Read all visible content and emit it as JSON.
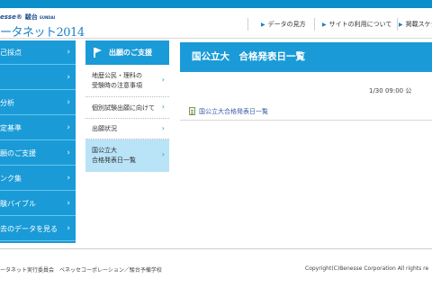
{
  "colors": {
    "accent": "#1a9bd7",
    "active_bg": "#b9e3f7",
    "link": "#3a5fa8"
  },
  "header": {
    "logo_brand": "esse®",
    "logo_sundai": "駿台",
    "logo_sundai_en": "SUNDAI",
    "logo_title": "ータネット2014",
    "links": [
      {
        "label": "データの見方",
        "icon": "arrow-right-icon"
      },
      {
        "label": "サイトの利用について",
        "icon": "arrow-right-icon"
      },
      {
        "label": "掲載スケジュー",
        "icon": "arrow-right-icon"
      }
    ]
  },
  "sidebar": {
    "items": [
      {
        "label": "己採点"
      },
      {
        "label": ""
      },
      {
        "label": "分析"
      },
      {
        "label": "定基準"
      },
      {
        "label": "願のご支援"
      },
      {
        "label": "ンク集"
      },
      {
        "label": "験バイブル"
      },
      {
        "label": "去のデータを見る"
      }
    ]
  },
  "submenu": {
    "title": "出願のご支援",
    "items": [
      {
        "line1": "地歴公民・理科の",
        "line2": "受験時の注意事項"
      },
      {
        "line1": "個別試験出願に向けて",
        "line2": ""
      },
      {
        "line1": "出願状況",
        "line2": ""
      },
      {
        "line1": "国公立大",
        "line2": "合格発表日一覧"
      }
    ]
  },
  "main": {
    "title": "国公立大　合格発表日一覧",
    "update": "1/30 09:00 公",
    "file_link": "国公立大合格発表日一覧"
  },
  "footer": {
    "left": "ータネット実行委員会　ベネッセコーポレーション／駿台予備学校",
    "right": "Copyright(C)Benesse Corporation All rights re"
  }
}
